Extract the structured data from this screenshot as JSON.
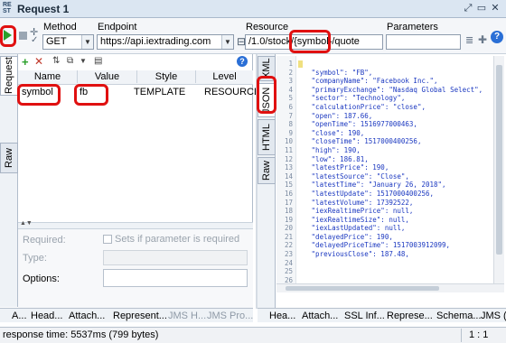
{
  "window": {
    "title": "Request 1",
    "icon_text": "RE\nST"
  },
  "toolbar": {
    "method_label": "Method",
    "method_value": "GET",
    "endpoint_label": "Endpoint",
    "endpoint_value": "https://api.iextrading.com",
    "resource_label": "Resource",
    "resource_value": "/1.0/stock/{symbol}/quote",
    "parameters_label": "Parameters",
    "parameters_value": ""
  },
  "left": {
    "vertical_tabs": [
      "Request",
      "Raw"
    ],
    "columns": [
      "Name",
      "Value",
      "Style",
      "Level"
    ],
    "rows": [
      {
        "name": "symbol",
        "value": "fb",
        "style": "TEMPLATE",
        "level": "RESOURCE"
      }
    ],
    "props": {
      "required_label": "Required:",
      "required_checkbox_label": "Sets if parameter is required",
      "type_label": "Type:",
      "options_label": "Options:"
    },
    "bottom_tabs": [
      "A...",
      "Head...",
      "Attach...",
      "Represent...",
      "JMS H...",
      "JMS Pro..."
    ]
  },
  "right": {
    "vertical_tabs": [
      "XML",
      "JSON",
      "HTML",
      "Raw"
    ],
    "line_numbers": "1\n2\n3\n4\n5\n6\n7\n8\n9\n10\n11\n12\n13\n14\n15\n16\n17\n18\n19\n20\n21\n22\n23\n24\n25\n26",
    "code": "{\n   \"symbol\": \"FB\",\n   \"companyName\": \"Facebook Inc.\",\n   \"primaryExchange\": \"Nasdaq Global Select\",\n   \"sector\": \"Technology\",\n   \"calculationPrice\": \"close\",\n   \"open\": 187.66,\n   \"openTime\": 1516977000463,\n   \"close\": 190,\n   \"closeTime\": 1517000400256,\n   \"high\": 190,\n   \"low\": 186.81,\n   \"latestPrice\": 190,\n   \"latestSource\": \"Close\",\n   \"latestTime\": \"January 26, 2018\",\n   \"latestUpdate\": 1517000400256,\n   \"latestVolume\": 17392522,\n   \"iexRealtimePrice\": null,\n   \"iexRealtimeSize\": null,\n   \"iexLastUpdated\": null,\n   \"delayedPrice\": 190,\n   \"delayedPriceTime\": 1517003912099,\n   \"previousClose\": 187.48,",
    "bottom_tabs": [
      "Hea...",
      "Attach...",
      "SSL Inf...",
      "Represe...",
      "Schema...",
      "JMS ("
    ],
    "cursor_pos": "1 : 1"
  },
  "status": {
    "text": "response time: 5537ms (799 bytes)"
  },
  "colors": {
    "accent": "#2a6fd6",
    "highlight": "#e01010",
    "code": "#1b38c0"
  }
}
